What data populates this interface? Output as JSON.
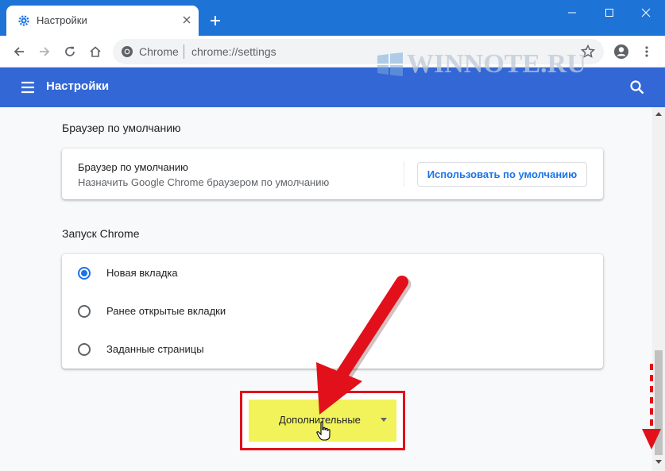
{
  "browser": {
    "tab_title": "Настройки",
    "tab_icon": "gear-icon",
    "omnibox_site": "Chrome",
    "omnibox_url": "chrome://settings",
    "accent_color": "#1e73d6"
  },
  "watermark": {
    "text": "WINNOTE.RU"
  },
  "header": {
    "title": "Настройки",
    "color": "#3367d6"
  },
  "default_browser": {
    "section_title": "Браузер по умолчанию",
    "row_title": "Браузер по умолчанию",
    "row_subtitle": "Назначить Google Chrome браузером по умолчанию",
    "button_label": "Использовать по умолчанию"
  },
  "startup": {
    "section_title": "Запуск Chrome",
    "options": [
      {
        "label": "Новая вкладка",
        "selected": true
      },
      {
        "label": "Ранее открытые вкладки",
        "selected": false
      },
      {
        "label": "Заданные страницы",
        "selected": false
      }
    ]
  },
  "advanced": {
    "label": "Дополнительные",
    "highlight_color": "#f2f25a",
    "frame_color": "#e2101a"
  },
  "annotations": {
    "arrow_color": "#e2101a"
  }
}
